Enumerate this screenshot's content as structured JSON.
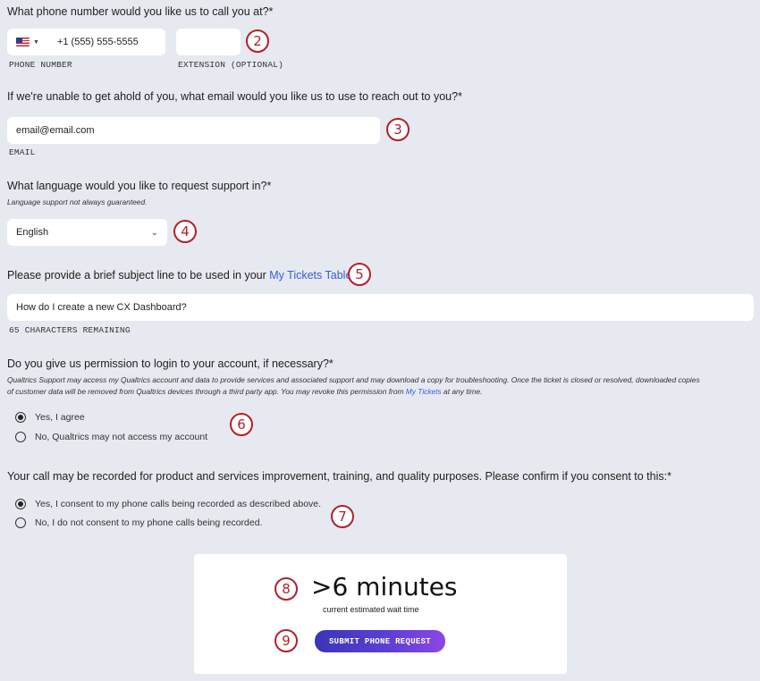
{
  "phone": {
    "question": "What phone number would you like us to call you at?*",
    "value": "+1 (555) 555-5555",
    "label": "PHONE NUMBER",
    "extension_label": "EXTENSION (OPTIONAL)",
    "extension_value": ""
  },
  "email": {
    "question": "If we're unable to get ahold of you, what email would you like us to use to reach out to you?*",
    "value": "email@email.com",
    "label": "EMAIL"
  },
  "language": {
    "question": "What language would you like to request support in?*",
    "note": "Language support not always guaranteed.",
    "selected": "English"
  },
  "subject": {
    "question_prefix": "Please provide a brief subject line to be used in your ",
    "question_link": "My Tickets Table",
    "question_suffix": ".",
    "value": "How do I create a new CX Dashboard?",
    "remaining": "65 CHARACTERS REMAINING"
  },
  "permission": {
    "question": "Do you give us permission to login to your account, if necessary?*",
    "note_line1": "Qualtrics Support may access my Qualtrics account and data to provide services and associated support and may download a copy for troubleshooting. Once the ticket is closed or resolved, downloaded copies",
    "note_line2_prefix": "of customer data will be removed from Qualtrics devices through a third party app. You may revoke this permission from ",
    "note_link": "My Tickets",
    "note_line2_suffix": " at any time.",
    "options": [
      "Yes, I agree",
      "No, Qualtrics may not access my account"
    ]
  },
  "recording": {
    "question": "Your call may be recorded for product and services improvement, training, and quality purposes. Please confirm if you consent to this:*",
    "options": [
      "Yes, I consent to my phone calls being recorded as described above.",
      "No, I do not consent to my phone calls being recorded."
    ]
  },
  "wait": {
    "time": ">6 minutes",
    "caption": "current estimated wait time",
    "submit_label": "SUBMIT PHONE REQUEST"
  },
  "markers": [
    "2",
    "3",
    "4",
    "5",
    "6",
    "7",
    "8",
    "9"
  ]
}
